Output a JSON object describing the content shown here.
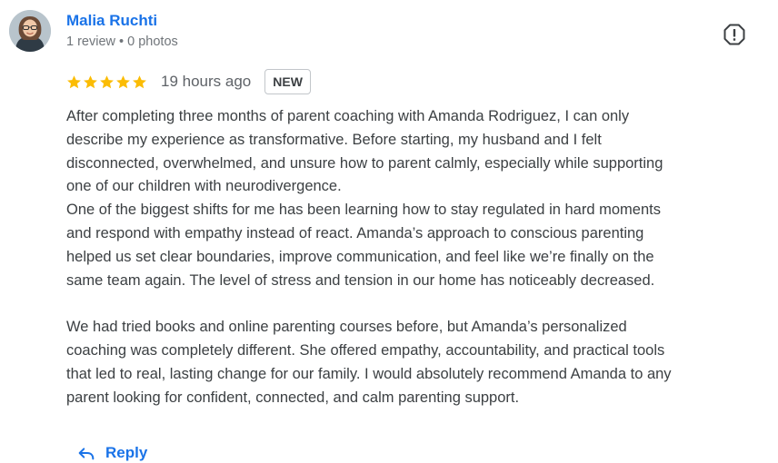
{
  "reviewer": {
    "name": "Malia Ruchti",
    "meta": "1 review • 0 photos"
  },
  "rating": {
    "stars": 5,
    "max_stars": 5,
    "time": "19 hours ago",
    "badge": "NEW"
  },
  "review": {
    "lines": [
      "After completing three months of parent coaching with Amanda Rodriguez, I can only",
      "describe my experience as transformative. Before starting, my husband and I felt",
      "disconnected, overwhelmed, and unsure how to parent calmly, especially while supporting",
      "one of our children with neurodivergence.",
      "One of the biggest shifts for me has been learning how to stay regulated in hard moments",
      "and respond with empathy instead of react. Amanda’s approach to conscious parenting",
      "helped us set clear boundaries, improve communication, and feel like we’re finally on the",
      "same team again. The level of stress and tension in our home has noticeably decreased.",
      "",
      "We had tried books and online parenting courses before, but Amanda’s personalized",
      "coaching was completely different. She offered empathy, accountability, and practical tools",
      "that led to real, lasting change for our family. I would absolutely recommend Amanda to any",
      "parent looking for confident, connected, and calm parenting support."
    ]
  },
  "actions": {
    "reply_label": "Reply"
  },
  "icons": {
    "avatar": "avatar-photo",
    "report": "report-icon",
    "star": "star-icon",
    "reply": "reply-arrow-icon"
  },
  "colors": {
    "name": "#1a73e8",
    "star": "#fbbc04",
    "meta": "#70757a",
    "text": "#3c4043",
    "reply": "#1a73e8"
  }
}
